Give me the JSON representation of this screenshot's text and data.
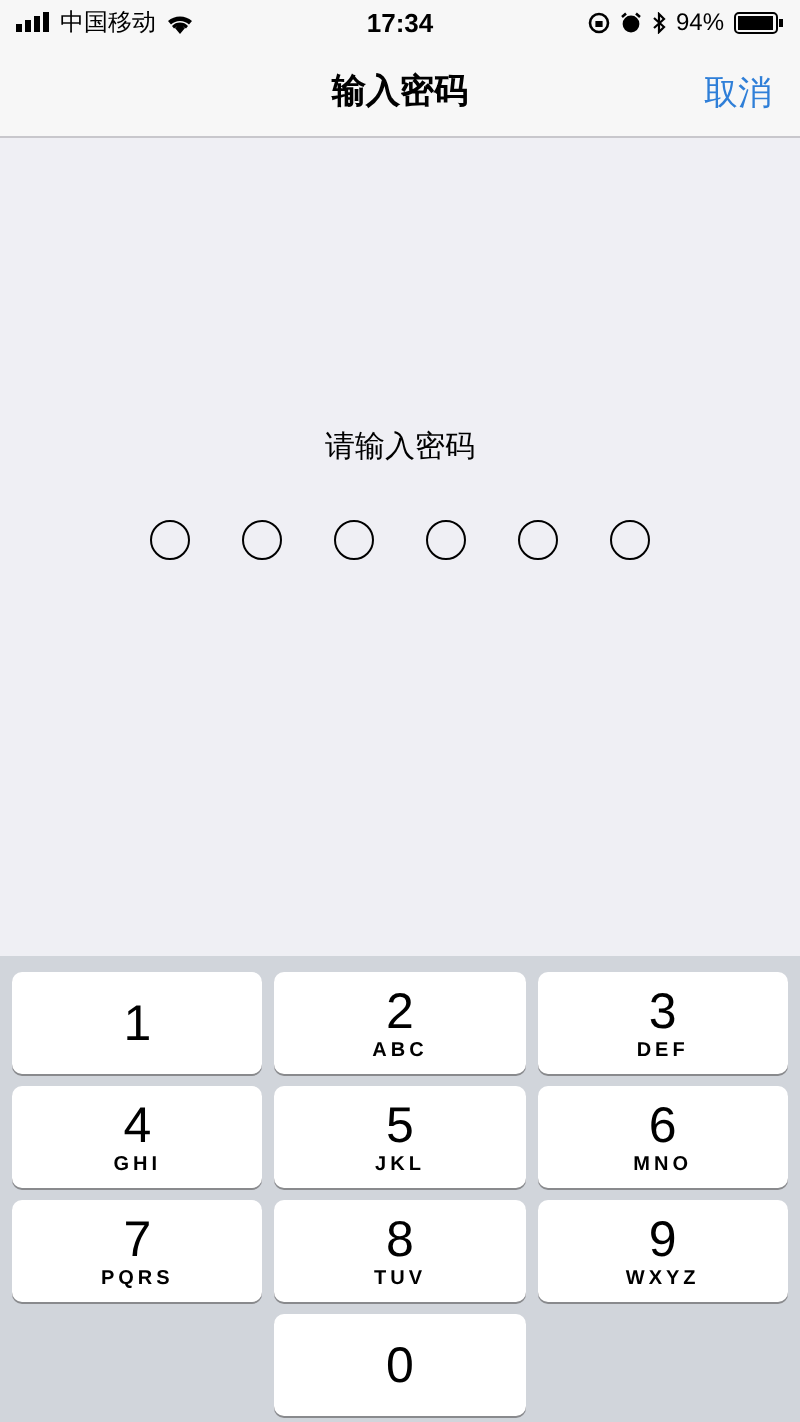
{
  "status_bar": {
    "carrier": "中国移动",
    "time": "17:34",
    "battery": "94%"
  },
  "nav_bar": {
    "title": "输入密码",
    "cancel": "取消"
  },
  "prompt": "请输入密码",
  "passcode_dots": [
    {
      "filled": false
    },
    {
      "filled": false
    },
    {
      "filled": false
    },
    {
      "filled": false
    },
    {
      "filled": false
    },
    {
      "filled": false
    }
  ],
  "keypad": [
    {
      "kind": "key",
      "digit": "1"
    },
    {
      "kind": "key",
      "digit": "2",
      "letters": "ABC"
    },
    {
      "kind": "key",
      "digit": "3",
      "letters": "DEF"
    },
    {
      "kind": "key",
      "digit": "4",
      "letters": "GHI"
    },
    {
      "kind": "key",
      "digit": "5",
      "letters": "JKL"
    },
    {
      "kind": "key",
      "digit": "6",
      "letters": "MNO"
    },
    {
      "kind": "key",
      "digit": "7",
      "letters": "PQRS"
    },
    {
      "kind": "key",
      "digit": "8",
      "letters": "TUV"
    },
    {
      "kind": "key",
      "digit": "9",
      "letters": "WXYZ"
    },
    {
      "kind": "blank"
    },
    {
      "kind": "key",
      "digit": "0"
    }
  ]
}
